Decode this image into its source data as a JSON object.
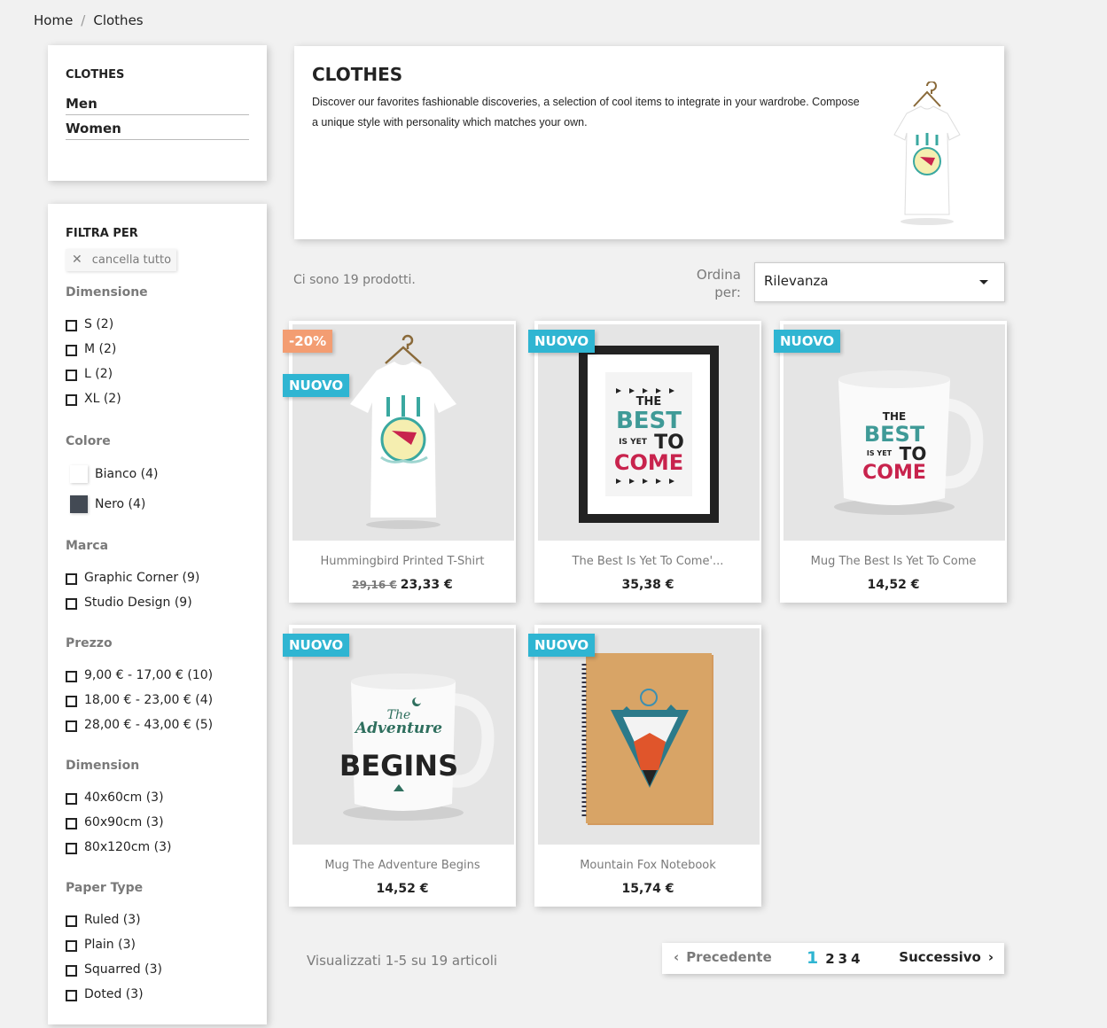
{
  "breadcrumb": {
    "home": "Home",
    "separator": "/",
    "current": "Clothes"
  },
  "categories": {
    "title": "CLOTHES",
    "items": [
      "Men",
      "Women"
    ]
  },
  "filters": {
    "title": "FILTRA PER",
    "clear_all": "cancella tutto",
    "groups": {
      "size": {
        "title": "Dimensione",
        "options": [
          "S (2)",
          "M (2)",
          "L (2)",
          "XL (2)"
        ]
      },
      "color": {
        "title": "Colore",
        "options": [
          {
            "label": "Bianco (4)",
            "color": "#ffffff"
          },
          {
            "label": "Nero (4)",
            "color": "#434a54"
          }
        ]
      },
      "brand": {
        "title": "Marca",
        "options": [
          "Graphic Corner (9)",
          "Studio Design (9)"
        ]
      },
      "price": {
        "title": "Prezzo",
        "options": [
          "9,00 € - 17,00 € (10)",
          "18,00 € - 23,00 € (4)",
          "28,00 € - 43,00 € (5)"
        ]
      },
      "dimension": {
        "title": "Dimension",
        "options": [
          "40x60cm (3)",
          "60x90cm (3)",
          "80x120cm (3)"
        ]
      },
      "paper": {
        "title": "Paper Type",
        "options": [
          "Ruled (3)",
          "Plain (3)",
          "Squarred (3)",
          "Doted (3)"
        ]
      }
    }
  },
  "header": {
    "title": "CLOTHES",
    "description": "Discover our favorites fashionable discoveries, a selection of cool items to integrate in your wardrobe. Compose a unique style with personality which matches your own."
  },
  "listing": {
    "count_text": "Ci sono 19 prodotti.",
    "sort_label": "Ordina per:",
    "sort_value": "Rilevanza"
  },
  "products": [
    {
      "name": "Hummingbird Printed T-Shirt",
      "old_price": "29,16 €",
      "price": "23,33 €",
      "badges": [
        "-20%",
        "NUOVO"
      ]
    },
    {
      "name": "The Best Is Yet To Come'...",
      "price": "35,38 €",
      "badges": [
        "NUOVO"
      ]
    },
    {
      "name": "Mug The Best Is Yet To Come",
      "price": "14,52 €",
      "badges": [
        "NUOVO"
      ]
    },
    {
      "name": "Mug The Adventure Begins",
      "price": "14,52 €",
      "badges": [
        "NUOVO"
      ]
    },
    {
      "name": "Mountain Fox Notebook",
      "price": "15,74 €",
      "badges": [
        "NUOVO"
      ]
    }
  ],
  "art": {
    "best": {
      "line1": "THE",
      "line2": "BEST",
      "line3": "IS YET",
      "line4": "TO",
      "line5": "COME"
    },
    "adventure": {
      "line1": "The",
      "line2": "Adventure",
      "line3": "BEGINS"
    }
  },
  "pagination": {
    "showing": "Visualizzati 1-5 su 19 articoli",
    "prev": "Precedente",
    "next": "Successivo",
    "pages": [
      "1",
      "2",
      "3",
      "4"
    ],
    "current": "1"
  },
  "colors": {
    "accent": "#2fb5d2",
    "discount": "#f39d72",
    "text": "#232323",
    "muted": "#7a7a7a"
  }
}
